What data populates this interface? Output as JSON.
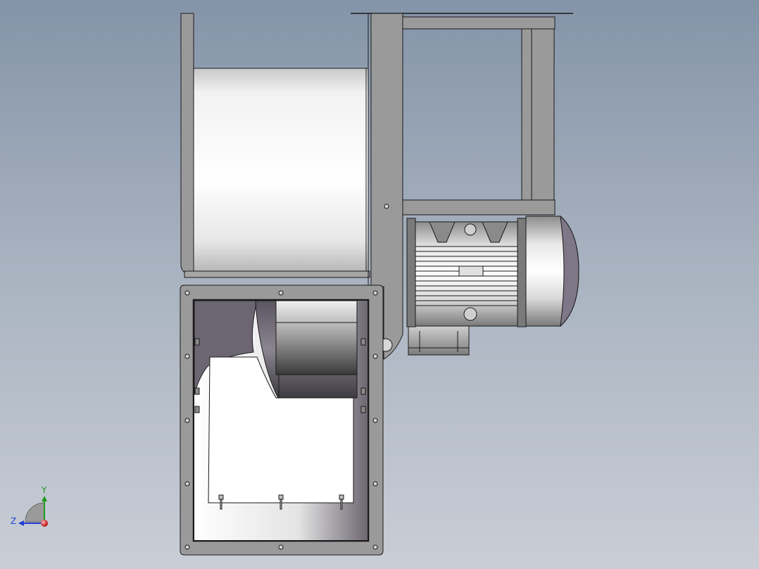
{
  "view": {
    "background_top": "#8494a8",
    "background_bottom": "#c9ced6"
  },
  "model": {
    "part_color": "#9a9a9a",
    "edge_color": "#1a1a1a",
    "highlight_color": "#ffffff",
    "impeller_shade": "#6b6672"
  },
  "triad": {
    "y_label": "Y",
    "z_label": "Z",
    "y_color": "#1f9a1f",
    "z_color": "#1f3fd0",
    "x_color": "#d01f1f"
  }
}
